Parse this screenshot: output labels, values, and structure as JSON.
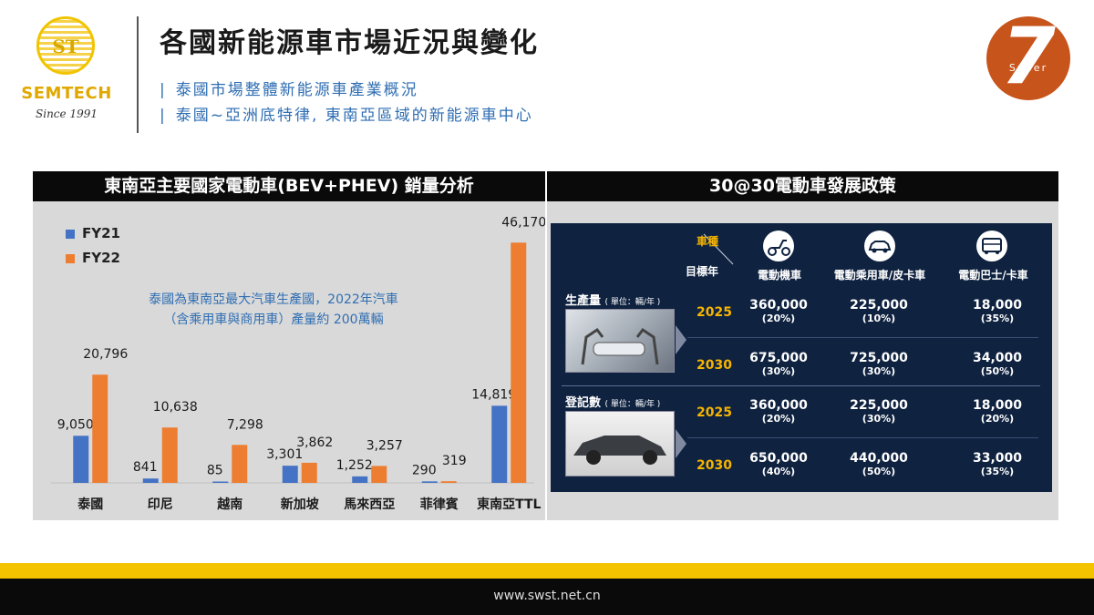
{
  "header": {
    "title": "各國新能源車市場近況與變化",
    "subtitle1": "泰國市場整體新能源車產業概況",
    "subtitle2": "泰國~亞洲底特律, 東南亞區域的新能源車中心",
    "bar_glyph": "|"
  },
  "logo": {
    "mark": "ST",
    "brand": "SEMTECH",
    "since": "Since 1991"
  },
  "badge": {
    "number": "7",
    "word": "Super"
  },
  "left_panel": {
    "heading": "東南亞主要國家電動車(BEV+PHEV) 銷量分析"
  },
  "right_panel": {
    "heading": "30@30電動車發展政策"
  },
  "chart_data": {
    "type": "bar",
    "categories": [
      "泰國",
      "印尼",
      "越南",
      "新加坡",
      "馬來西亞",
      "菲律賓",
      "東南亞TTL"
    ],
    "series": [
      {
        "name": "FY21",
        "values": [
          9050,
          841,
          85,
          3301,
          1252,
          290,
          14819
        ],
        "labels": [
          "9,050",
          "841",
          "85",
          "3,301",
          "1,252",
          "290",
          "14,819"
        ],
        "color": "#4472c4"
      },
      {
        "name": "FY22",
        "values": [
          20796,
          10638,
          7298,
          3862,
          3257,
          319,
          46170
        ],
        "labels": [
          "20,796",
          "10,638",
          "7,298",
          "3,862",
          "3,257",
          "319",
          "46,170"
        ],
        "color": "#ed7d31"
      }
    ],
    "ylim": [
      0,
      50000
    ],
    "grid": false,
    "legend": "top-left",
    "annotation": [
      "泰國為東南亞最大汽車生產國，2022年汽車",
      "（含乘用車與商用車）產量約 200萬輛"
    ]
  },
  "policy": {
    "corner_top": "車種",
    "corner_bottom": "目標年",
    "columns": [
      "電動機車",
      "電動乘用車/皮卡車",
      "電動巴士/卡車"
    ],
    "column_icons": [
      "scooter-icon",
      "car-icon",
      "bus-icon"
    ],
    "groups": [
      {
        "label": "生產量",
        "unit": "( 單位：輛/年 )",
        "rows": [
          {
            "year": "2025",
            "cells": [
              [
                "360,000",
                "(20%)"
              ],
              [
                "225,000",
                "(10%)"
              ],
              [
                "18,000",
                "(35%)"
              ]
            ]
          },
          {
            "year": "2030",
            "cells": [
              [
                "675,000",
                "(30%)"
              ],
              [
                "725,000",
                "(30%)"
              ],
              [
                "34,000",
                "(50%)"
              ]
            ]
          }
        ]
      },
      {
        "label": "登記數",
        "unit": "( 單位：輛/年 )",
        "rows": [
          {
            "year": "2025",
            "cells": [
              [
                "360,000",
                "(20%)"
              ],
              [
                "225,000",
                "(30%)"
              ],
              [
                "18,000",
                "(20%)"
              ]
            ]
          },
          {
            "year": "2030",
            "cells": [
              [
                "650,000",
                "(40%)"
              ],
              [
                "440,000",
                "(50%)"
              ],
              [
                "33,000",
                "(35%)"
              ]
            ]
          }
        ]
      }
    ]
  },
  "footer": {
    "url": "www.swst.net.cn"
  },
  "colors": {
    "accent_orange": "#c7541a",
    "brand_yellow": "#f4c300",
    "policy_bg": "#0f2240",
    "year_gold": "#f5b400"
  }
}
